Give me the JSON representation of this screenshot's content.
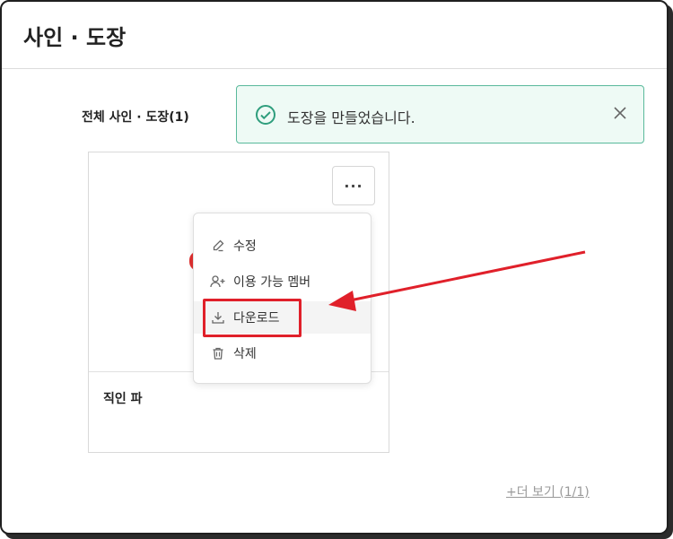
{
  "page": {
    "title": "사인 · 도장"
  },
  "section": {
    "title": "전체 사인 · 도장(1)"
  },
  "card": {
    "name": "직인 파",
    "more_button_label": "···"
  },
  "menu": {
    "items": [
      {
        "label": "수정",
        "icon": "edit-icon"
      },
      {
        "label": "이용 가능 멤버",
        "icon": "add-user-icon"
      },
      {
        "label": "다운로드",
        "icon": "download-icon"
      },
      {
        "label": "삭제",
        "icon": "trash-icon"
      }
    ]
  },
  "toast": {
    "message": "도장을 만들었습니다.",
    "icon": "check-circle-icon",
    "close_icon": "close-icon",
    "color": "#2f9e7d"
  },
  "footer": {
    "more_link": "+더 보기 (1/1)"
  },
  "colors": {
    "annotation": "#e0202a",
    "toast_border": "#59b99b",
    "toast_bg": "#eefaf5"
  }
}
